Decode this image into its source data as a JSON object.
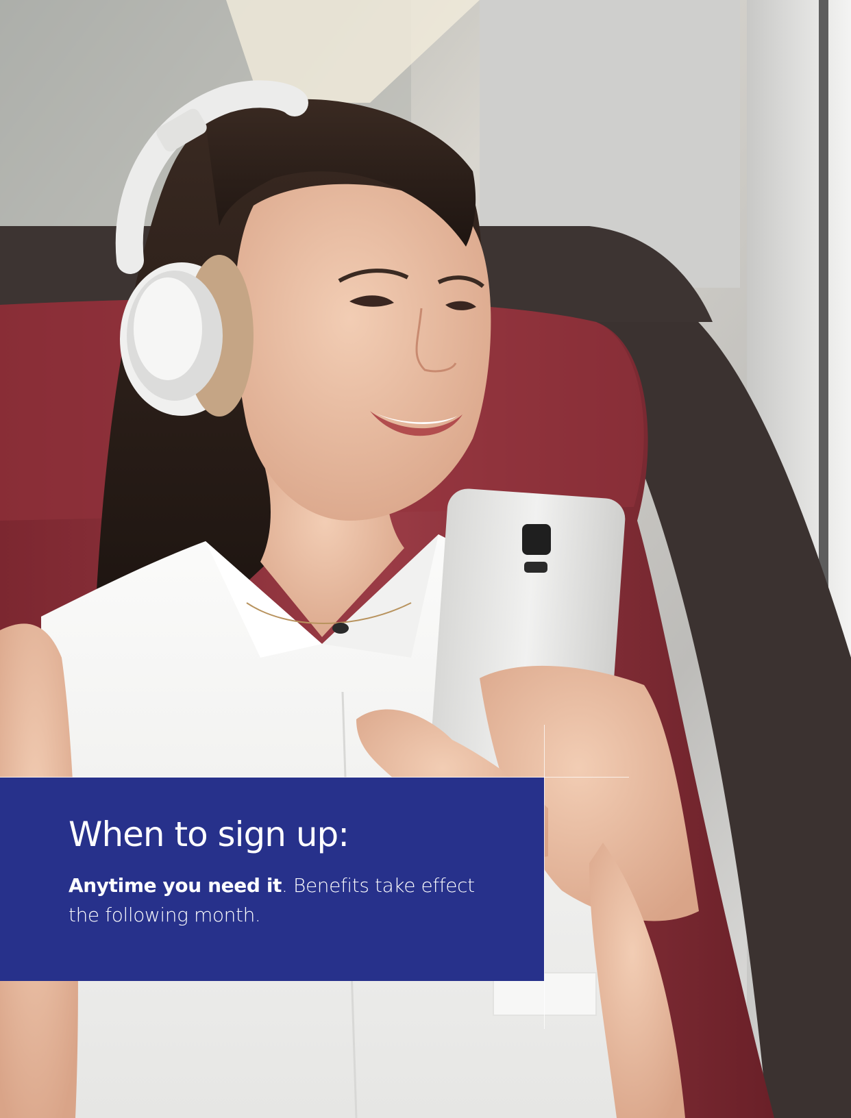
{
  "card": {
    "title": "When to sign up:",
    "body_bold": "Anytime you need it",
    "body_rest_line1": ". Benefits take effect",
    "body_rest_line2": "the following month."
  },
  "colors": {
    "card_background": "#27318b",
    "card_text": "#ffffff",
    "seat_red": "#8a2f38"
  },
  "photo": {
    "icons": [
      "headphones-icon",
      "smartphone-icon"
    ]
  }
}
